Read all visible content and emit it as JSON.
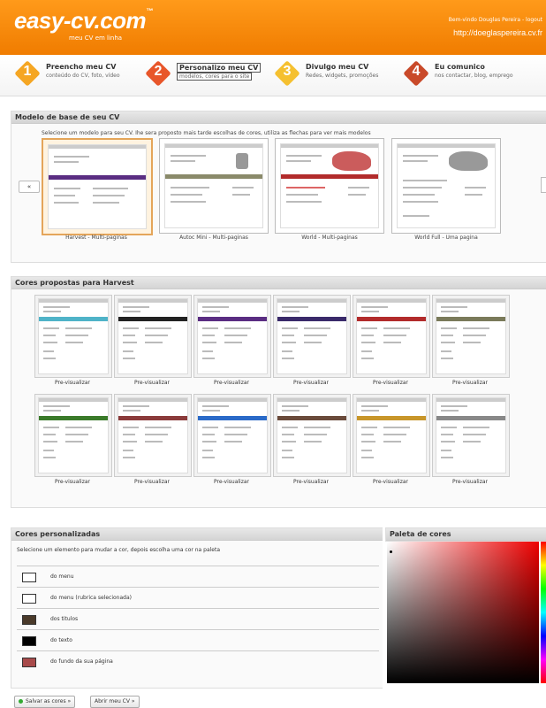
{
  "header": {
    "logo_main": "easy-cv",
    "logo_domain": ".com",
    "tagline": "meu CV em linha",
    "welcome": "Bem-vindo Douglas Pereira - logout",
    "site_url": "http://doeglaspereira.cv.fr"
  },
  "steps": [
    {
      "num": "1",
      "title": "Preencho meu CV",
      "sub": "conteúdo do CV, foto, vídeo",
      "color": "#f5a623"
    },
    {
      "num": "2",
      "title": "Personalizo meu CV",
      "sub": "modelos, cores para o site",
      "color": "#e8562a"
    },
    {
      "num": "3",
      "title": "Divulgo meu CV",
      "sub": "Redes, widgets, promoções",
      "color": "#f5c030"
    },
    {
      "num": "4",
      "title": "Eu comunico",
      "sub": "nos contactar, blog, emprego",
      "color": "#c94a2a"
    }
  ],
  "models_panel": {
    "title": "Modelo de base de seu CV",
    "instruction": "Selecione um modelo para seu CV. Ihe sera proposto mais tarde escolhas de cores, utiliza as flechas para ver mais modelos",
    "prev_arrow": "«",
    "models": [
      {
        "label": "Harvest - Multi-paginas",
        "accent": "#5a2d82"
      },
      {
        "label": "Autoc Mini - Multi-paginas",
        "accent": "#8a8a6a"
      },
      {
        "label": "World - Multi-paginas",
        "accent": "#b22b2b"
      },
      {
        "label": "World Full - Uma pagina",
        "accent": "#888888"
      }
    ]
  },
  "colors_panel": {
    "title": "Cores propostas para Harvest",
    "preview_label": "Pre-visualizar",
    "swatches": [
      "#4fb3c8",
      "#222222",
      "#5a2d82",
      "#3a2a6a",
      "#b22b2b",
      "#7a7a5a",
      "#3a7a2a",
      "#8a3a3a",
      "#2a6ac8",
      "#6a4a3a",
      "#c8962a",
      "#888888"
    ]
  },
  "custom_panel": {
    "title": "Cores personalizadas",
    "instruction": "Selecione um elemento para mudar a cor, depois escolha uma cor na paleta",
    "items": [
      {
        "label": "do menu",
        "color": "#ffffff"
      },
      {
        "label": "do menu (rubrica selecionada)",
        "color": "#ffffff"
      },
      {
        "label": "dos titulos",
        "color": "#4a3a2a"
      },
      {
        "label": "do texto",
        "color": "#000000"
      },
      {
        "label": "do fundo da sua página",
        "color": "#a84a4a"
      }
    ]
  },
  "palette_panel": {
    "title": "Paleta de cores"
  },
  "buttons": {
    "save": "Salvar as cores »",
    "open": "Abrir meu CV »"
  }
}
